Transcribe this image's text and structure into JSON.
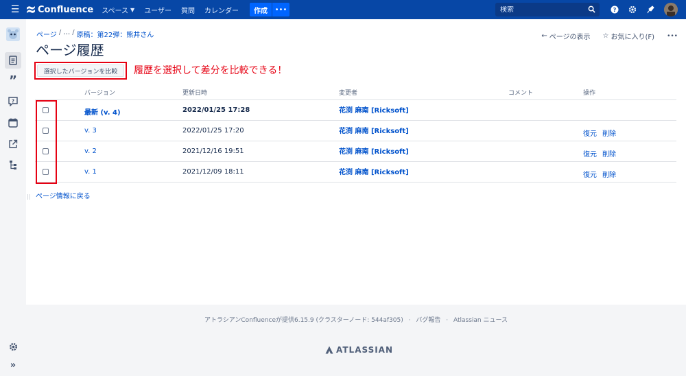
{
  "topnav": {
    "menu_icon": "menu-icon",
    "logo_text": "Confluence",
    "items": [
      {
        "label": "スペース",
        "has_dropdown": true
      },
      {
        "label": "ユーザー"
      },
      {
        "label": "質問"
      },
      {
        "label": "カレンダー"
      }
    ],
    "create_label": "作成",
    "more_label": "•••",
    "search_placeholder": "検索",
    "right_icons": [
      "help-icon",
      "settings-icon",
      "notifications-icon"
    ]
  },
  "breadcrumb": {
    "items": [
      "ページ",
      "…",
      "原稿：第22弾：熊井さん"
    ]
  },
  "page_actions": {
    "view_page": "ページの表示",
    "favorite": "お気に入り(F)",
    "more": "•••"
  },
  "page_title": "ページ履歴",
  "compare_button": "選択したバージョンを比較",
  "annotation": "履歴を選択して差分を比較できる！",
  "table": {
    "headers": {
      "version": "バージョン",
      "updated": "更新日時",
      "author": "変更者",
      "comment": "コメント",
      "actions": "操作"
    },
    "rows": [
      {
        "version": "最新 (v. 4)",
        "date": "2022/01/25 17:28",
        "author": "花渕 麻南 [Ricksoft]",
        "restore": "",
        "delete": "",
        "current": true
      },
      {
        "version": "v. 3",
        "date": "2022/01/25 17:20",
        "author": "花渕 麻南 [Ricksoft]",
        "restore": "復元",
        "delete": "削除",
        "current": false
      },
      {
        "version": "v. 2",
        "date": "2021/12/16 19:51",
        "author": "花渕 麻南 [Ricksoft]",
        "restore": "復元",
        "delete": "削除",
        "current": false
      },
      {
        "version": "v. 1",
        "date": "2021/12/09 18:11",
        "author": "花渕 麻南 [Ricksoft]",
        "restore": "復元",
        "delete": "削除",
        "current": false
      }
    ]
  },
  "back_link": "ページ情報に戻る",
  "footer": {
    "powered_by": "アトラシアンConfluenceが提供6.15.9 (クラスターノード: 544af305)",
    "bug_report": "バグ報告",
    "news": "Atlassian ニュース",
    "logo_text": "ATLASSIAN"
  },
  "colors": {
    "nav_bg": "#0747a6",
    "create_btn": "#0065ff",
    "link": "#0052cc",
    "annotation_red": "#e60012"
  }
}
